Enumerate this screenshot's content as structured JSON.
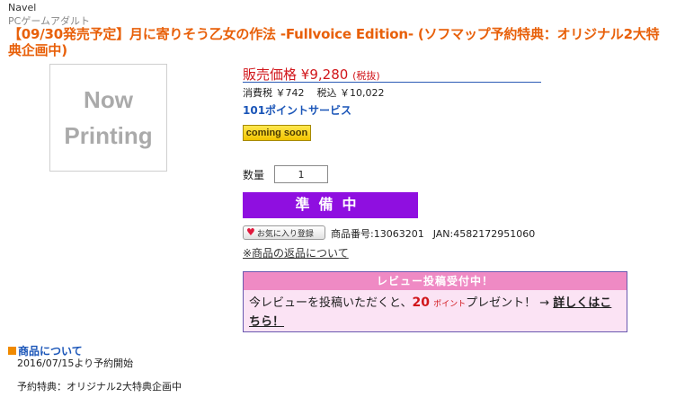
{
  "brand": "Navel",
  "category": "PCゲームアダルト",
  "product_title": "【09/30発売予定】月に寄りそう乙女の作法 -Fullvoice Edition- (ソフマップ予約特典：オリジナル2大特典企画中)",
  "image_placeholder": {
    "line1": "Now",
    "line2": "Printing"
  },
  "price": {
    "label": "販売価格",
    "value": "¥9,280",
    "tax_note": "(税抜)",
    "consumption_tax": "消費税 ￥742",
    "tax_included": "税込 ￥10,022"
  },
  "points_service": "101ポイントサービス",
  "status_badge": "coming soon",
  "quantity": {
    "label": "数量",
    "value": "1"
  },
  "action_button": "準備中",
  "favorite_button": "お気に入り登録",
  "product_number": "商品番号:13063201",
  "jan": "JAN:4582172951060",
  "return_policy_link": "※商品の返品について",
  "review": {
    "header": "レビュー投稿受付中！",
    "text_before": "今レビューを投稿いただくと、",
    "points": "20",
    "points_unit": "ポイント",
    "text_after": "プレゼント！ → ",
    "details_link": "詳しくはこちら！"
  },
  "about": {
    "heading": "商品について",
    "line1": "2016/07/15より予約開始",
    "line2": "予約特典：オリジナル2大特典企画中"
  },
  "colors": {
    "title": "#e8600a",
    "price": "#d1161b",
    "button": "#8f0fe0",
    "link": "#1a55b8",
    "review_header": "#ef8ac4",
    "review_bg": "#fbe3f4"
  }
}
